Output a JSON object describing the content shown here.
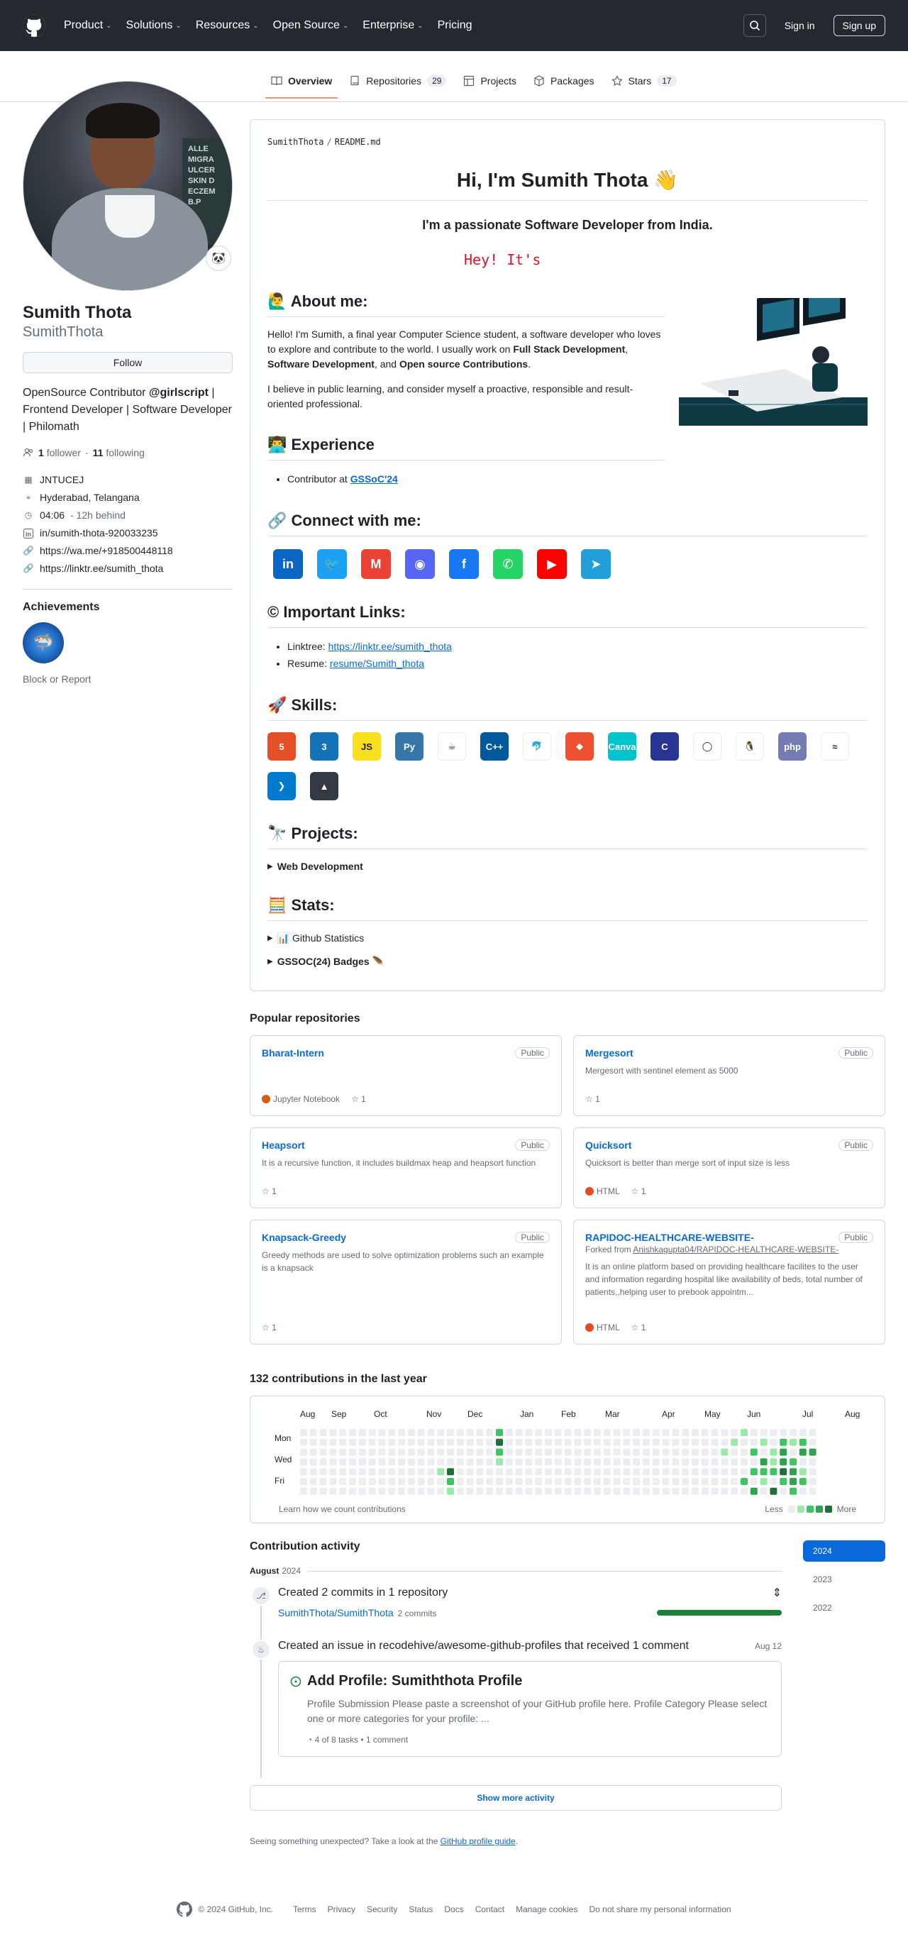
{
  "nav": {
    "items": [
      {
        "label": "Product"
      },
      {
        "label": "Solutions"
      },
      {
        "label": "Resources"
      },
      {
        "label": "Open Source"
      },
      {
        "label": "Enterprise"
      }
    ],
    "pricing": "Pricing",
    "signin": "Sign in",
    "signup": "Sign up"
  },
  "tabs": {
    "overview": "Overview",
    "repositories": "Repositories",
    "repositories_count": "29",
    "projects": "Projects",
    "packages": "Packages",
    "stars": "Stars",
    "stars_count": "17"
  },
  "profile": {
    "status_emoji": "🐼",
    "fullname": "Sumith Thota",
    "username": "SumithThota",
    "follow": "Follow",
    "bio_pre": "OpenSource Contributor ",
    "bio_org": "@girlscript",
    "bio_post": " | Frontend Developer | Software Developer | Philomath",
    "followers": "1",
    "followers_label": "follower",
    "dot": "·",
    "following": "11",
    "following_label": "following",
    "org": "JNTUCEJ",
    "location": "Hyderabad, Telangana",
    "time": "04:06",
    "time_note": "- 12h behind",
    "linkedin": "in/sumith-thota-920033235",
    "wa": "https://wa.me/+918500448118",
    "linktree": "https://linktr.ee/sumith_thota",
    "achievements": "Achievements",
    "block": "Block or Report",
    "avatar_text": "ALLE MIGRA ULCER SKIN D ECZEM B.P"
  },
  "readme": {
    "path_user": "SumithThota",
    "path_file": "README.md",
    "h1": "Hi, I'm Sumith Thota 👋",
    "sub": "I'm a passionate Software Developer from India.",
    "typing": "Hey! It's",
    "about_title": "🙋‍♂️ About me:",
    "about_p1_a": "Hello! I'm Sumith, a final year Computer Science student, a software developer who loves to explore and contribute to the world. I usually work on ",
    "about_p1_b": "Full Stack Development",
    "about_p1_c": ", ",
    "about_p1_d": "Software Development",
    "about_p1_e": ", and ",
    "about_p1_f": "Open source Contributions",
    "about_p1_g": ".",
    "about_p2": "I believe in public learning, and consider myself a proactive, responsible and result-oriented professional.",
    "exp_title": "👨‍💻 Experience",
    "exp_item": "Contributor at ",
    "exp_link": "GSSoC'24",
    "connect_title": "🔗 Connect with me:",
    "social": [
      {
        "icon": "linkedin-icon",
        "glyph": "in",
        "color": "#0a66c2"
      },
      {
        "icon": "twitter-icon",
        "glyph": "🐦",
        "color": "#1da1f2"
      },
      {
        "icon": "gmail-icon",
        "glyph": "M",
        "color": "#ea4335"
      },
      {
        "icon": "discord-icon",
        "glyph": "◉",
        "color": "#5865f2"
      },
      {
        "icon": "facebook-icon",
        "glyph": "f",
        "color": "#1877f2"
      },
      {
        "icon": "whatsapp-icon",
        "glyph": "✆",
        "color": "#25d366"
      },
      {
        "icon": "youtube-icon",
        "glyph": "▶",
        "color": "#ff0000"
      },
      {
        "icon": "telegram-icon",
        "glyph": "➤",
        "color": "#229ed9"
      }
    ],
    "links_title": "© Important Links:",
    "linktree_label": "Linktree: ",
    "linktree_url": "https://linktr.ee/sumith_thota",
    "resume_label": "Resume: ",
    "resume_url": "resume/Sumith_thota",
    "skills_title": "🚀 Skills:",
    "skills": [
      {
        "icon": "html5-icon",
        "glyph": "5",
        "color": "#e34f26"
      },
      {
        "icon": "css3-icon",
        "glyph": "3",
        "color": "#1572b6"
      },
      {
        "icon": "javascript-icon",
        "glyph": "JS",
        "color": "#f7df1e"
      },
      {
        "icon": "python-icon",
        "glyph": "Py",
        "color": "#3776ab"
      },
      {
        "icon": "java-icon",
        "glyph": "☕",
        "color": "#ffffff"
      },
      {
        "icon": "cplusplus-icon",
        "glyph": "C++",
        "color": "#00599c"
      },
      {
        "icon": "mysql-icon",
        "glyph": "🐬",
        "color": "#ffffff"
      },
      {
        "icon": "git-icon",
        "glyph": "◆",
        "color": "#f05032"
      },
      {
        "icon": "canva-icon",
        "glyph": "Canva",
        "color": "#00c4cc"
      },
      {
        "icon": "c-icon",
        "glyph": "C",
        "color": "#283593"
      },
      {
        "icon": "jupyter-icon",
        "glyph": "◯",
        "color": "#ffffff"
      },
      {
        "icon": "linux-icon",
        "glyph": "🐧",
        "color": "#ffffff"
      },
      {
        "icon": "php-icon",
        "glyph": "php",
        "color": "#777bb4"
      },
      {
        "icon": "tailwind-icon",
        "glyph": "≈",
        "color": "#ffffff"
      },
      {
        "icon": "vscode-icon",
        "glyph": "❯",
        "color": "#007acc"
      },
      {
        "icon": "vercel-icon",
        "glyph": "▲",
        "color": "#333a44"
      }
    ],
    "projects_title": "🔭 Projects:",
    "projects_details": "Web Development",
    "stats_title": "🧮 Stats:",
    "stats_details": "📊 Github Statistics",
    "gssoc_details": "GSSOC(24) Badges 🪶"
  },
  "popular": {
    "title": "Popular repositories",
    "repos": [
      {
        "name": "Bharat-Intern",
        "vis": "Public",
        "desc": "",
        "lang": "Jupyter Notebook",
        "lang_color": "#da5b0b",
        "stars": "1"
      },
      {
        "name": "Mergesort",
        "vis": "Public",
        "desc": "Mergesort with sentinel element as 5000",
        "lang": "",
        "lang_color": "",
        "stars": "1"
      },
      {
        "name": "Heapsort",
        "vis": "Public",
        "desc": "It is a recursive function, it includes buildmax heap and heapsort function",
        "lang": "",
        "lang_color": "",
        "stars": "1"
      },
      {
        "name": "Quicksort",
        "vis": "Public",
        "desc": "Quicksort is better than merge sort of input size is less",
        "lang": "HTML",
        "lang_color": "#e34c26",
        "stars": "1"
      },
      {
        "name": "Knapsack-Greedy",
        "vis": "Public",
        "desc": "Greedy methods are used to solve optimization problems such an example is a knapsack",
        "lang": "",
        "lang_color": "",
        "stars": "1"
      },
      {
        "name": "RAPIDOC-HEALTHCARE-WEBSITE-",
        "vis": "Public",
        "fork_label": "Forked from ",
        "fork_src": "Anishkagupta04/RAPIDOC-HEALTHCARE-WEBSITE-",
        "desc": "It is an online platform based on providing healthcare facilites to the user and information regarding hospital like availability of beds, total number of patients,,helping user to prebook appointm...",
        "lang": "HTML",
        "lang_color": "#e34c26",
        "stars": "1"
      }
    ]
  },
  "contrib": {
    "title": "132 contributions in the last year",
    "months": [
      "Aug",
      "Sep",
      "Oct",
      "Nov",
      "Dec",
      "Jan",
      "Feb",
      "Mar",
      "Apr",
      "May",
      "Jun",
      "Jul",
      "Aug"
    ],
    "days": [
      "Mon",
      "Wed",
      "Fri"
    ],
    "learn": "Learn how we count contributions",
    "less": "Less",
    "more": "More",
    "level_colors": [
      "#ebedf0",
      "#9be9a8",
      "#40c463",
      "#30a14e",
      "#216e39"
    ]
  },
  "activity": {
    "title": "Contribution activity",
    "month": "August",
    "year": "2024",
    "commit_title": "Created 2 commits in 1 repository",
    "commit_repo": "SumithThota/SumithThota",
    "commit_count": "2 commits",
    "issue_title": "Created an issue in recodehive/awesome-github-profiles that received 1 comment",
    "issue_date": "Aug 12",
    "issue_name": "Add Profile: Sumiththota Profile",
    "issue_body": "Profile Submission Please paste a screenshot of your GitHub profile here. Profile Category Please select one or more categories for your profile: ...",
    "issue_tasks": "4 of 8 tasks",
    "issue_comments": "• 1 comment",
    "show_more": "Show more activity",
    "guide_pre": "Seeing something unexpected? Take a look at the ",
    "guide_link": "GitHub profile guide",
    "guide_post": ".",
    "years": [
      "2024",
      "2023",
      "2022"
    ]
  },
  "footer": {
    "copy": "© 2024 GitHub, Inc.",
    "links": [
      "Terms",
      "Privacy",
      "Security",
      "Status",
      "Docs",
      "Contact",
      "Manage cookies",
      "Do not share my personal information"
    ]
  }
}
